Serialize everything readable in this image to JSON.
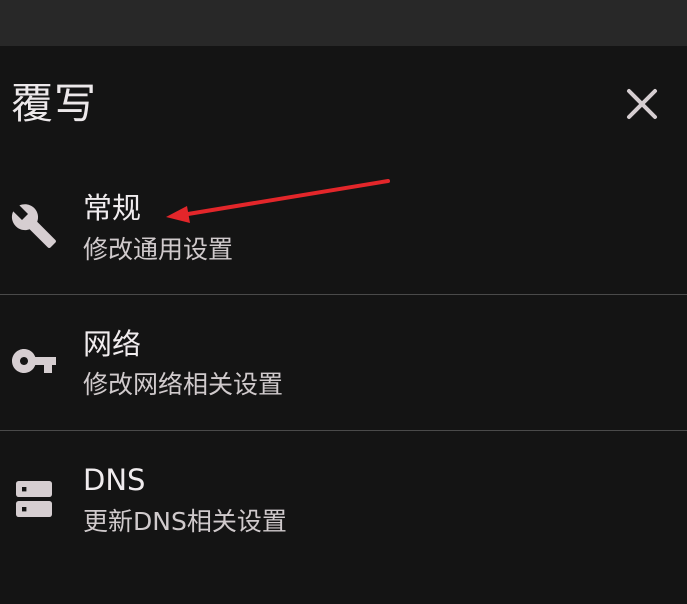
{
  "header": {
    "title": "覆写",
    "close_icon": "close-icon"
  },
  "items": [
    {
      "icon": "wrench-icon",
      "title": "常规",
      "subtitle": "修改通用设置"
    },
    {
      "icon": "key-icon",
      "title": "网络",
      "subtitle": "修改网络相关设置"
    },
    {
      "icon": "dns-server-icon",
      "title": "DNS",
      "subtitle": "更新DNS相关设置"
    }
  ],
  "colors": {
    "background": "#141414",
    "top_bar": "#282828",
    "divider": "#4a4a4a",
    "icon": "#d6ced1",
    "annotation_arrow": "#e3262a"
  }
}
